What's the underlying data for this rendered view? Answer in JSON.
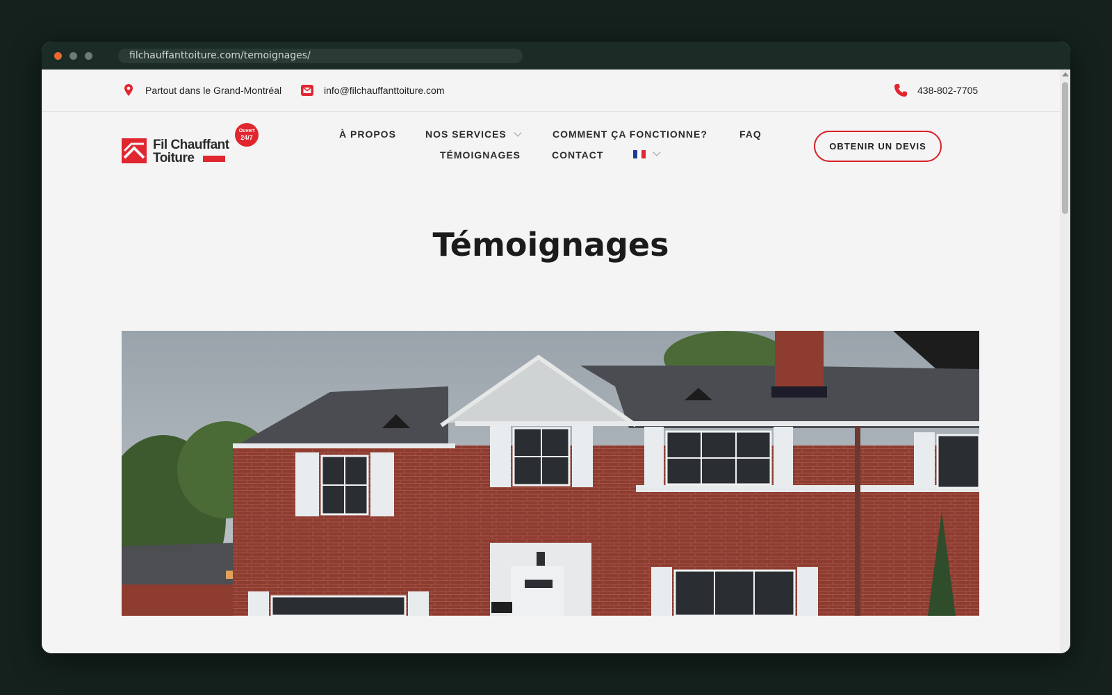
{
  "browser": {
    "url": "filchauffanttoiture.com/temoignages/"
  },
  "topbar": {
    "location": "Partout dans le Grand-Montréal",
    "email": "info@filchauffanttoiture.com",
    "phone": "438-802-7705"
  },
  "logo": {
    "line1": "Fil Chauffant",
    "line2": "Toiture",
    "badge_top": "Ouvert",
    "badge_bottom": "24/7"
  },
  "nav": {
    "items": [
      {
        "label": "À PROPOS"
      },
      {
        "label": "NOS SERVICES"
      },
      {
        "label": "COMMENT ÇA FONCTIONNE?"
      },
      {
        "label": "FAQ"
      },
      {
        "label": "TÉMOIGNAGES"
      },
      {
        "label": "CONTACT"
      }
    ],
    "cta": "OBTENIR UN DEVIS"
  },
  "main": {
    "title": "Témoignages"
  },
  "colors": {
    "accent": "#e0262f",
    "background": "#f4f4f4",
    "chrome": "#1b2b26"
  }
}
